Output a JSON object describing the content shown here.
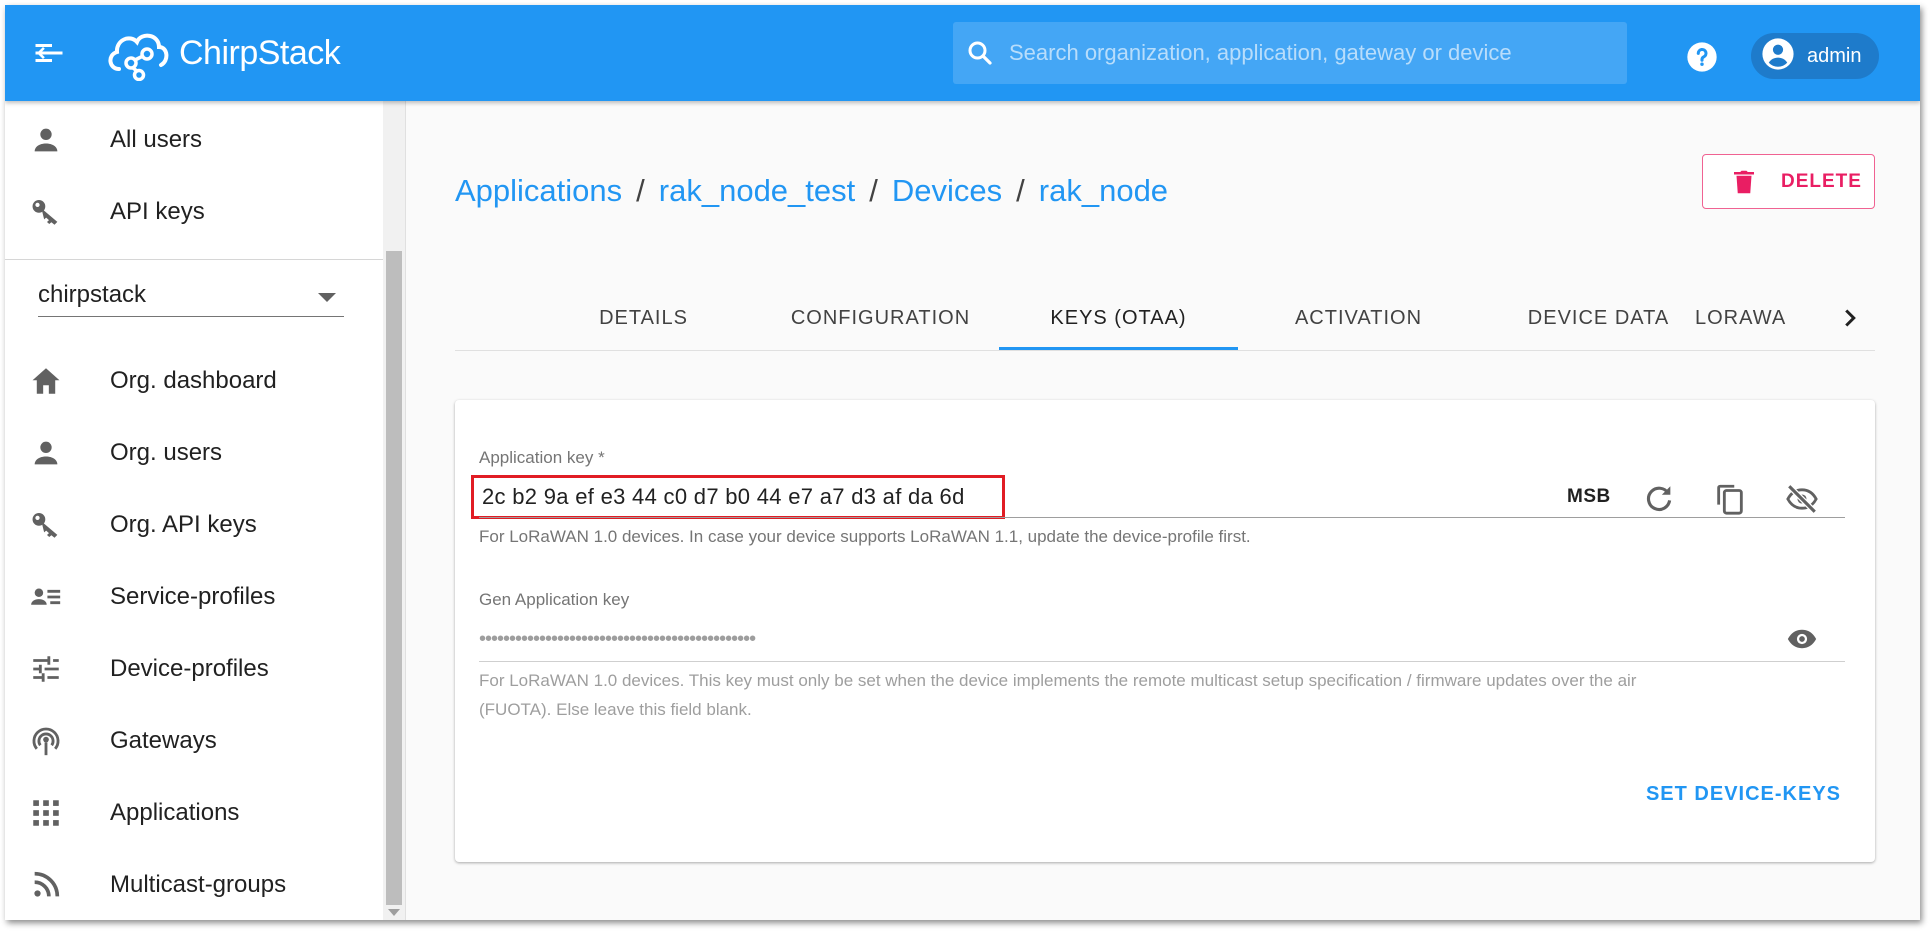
{
  "appbar": {
    "brand": "ChirpStack",
    "search_placeholder": "Search organization, application, gateway or device",
    "user_label": "admin"
  },
  "sidebar": {
    "top_items": [
      {
        "label": "All users",
        "icon": "person-icon"
      },
      {
        "label": "API keys",
        "icon": "key-icon"
      }
    ],
    "org_select": "chirpstack",
    "org_items": [
      {
        "label": "Org. dashboard",
        "icon": "home-icon"
      },
      {
        "label": "Org. users",
        "icon": "person-icon"
      },
      {
        "label": "Org. API keys",
        "icon": "key-icon"
      },
      {
        "label": "Service-profiles",
        "icon": "service-profiles-icon"
      },
      {
        "label": "Device-profiles",
        "icon": "tune-icon"
      },
      {
        "label": "Gateways",
        "icon": "gateway-icon"
      },
      {
        "label": "Applications",
        "icon": "apps-grid-icon"
      },
      {
        "label": "Multicast-groups",
        "icon": "rss-icon"
      }
    ]
  },
  "breadcrumb": {
    "items": [
      "Applications",
      "rak_node_test",
      "Devices",
      "rak_node"
    ],
    "separator": "/"
  },
  "delete_label": "DELETE",
  "tabs": {
    "items": [
      "DETAILS",
      "CONFIGURATION",
      "KEYS (OTAA)",
      "ACTIVATION",
      "DEVICE DATA",
      "LORAWA"
    ],
    "active_index": 2
  },
  "keys_form": {
    "app_key_label": "Application key *",
    "app_key_value": "2c b2 9a ef e3 44 c0 d7 b0 44 e7 a7 d3 af da 6d",
    "byte_order": "MSB",
    "app_key_helper": "For LoRaWAN 1.0 devices. In case your device supports LoRaWAN 1.1, update the device-profile first.",
    "gen_key_label": "Gen Application key",
    "gen_key_masked": "••••••••••••••••••••••••••••••••••••••••••••••",
    "gen_key_helper_line1": "For LoRaWAN 1.0 devices. This key must only be set when the device implements the remote multicast setup specification / firmware updates over the air",
    "gen_key_helper_line2": "(FUOTA). Else leave this field blank.",
    "submit_label": "SET DEVICE-KEYS"
  },
  "colors": {
    "primary": "#2196f3",
    "delete": "#e91e63",
    "highlight_box": "#e11c24"
  }
}
